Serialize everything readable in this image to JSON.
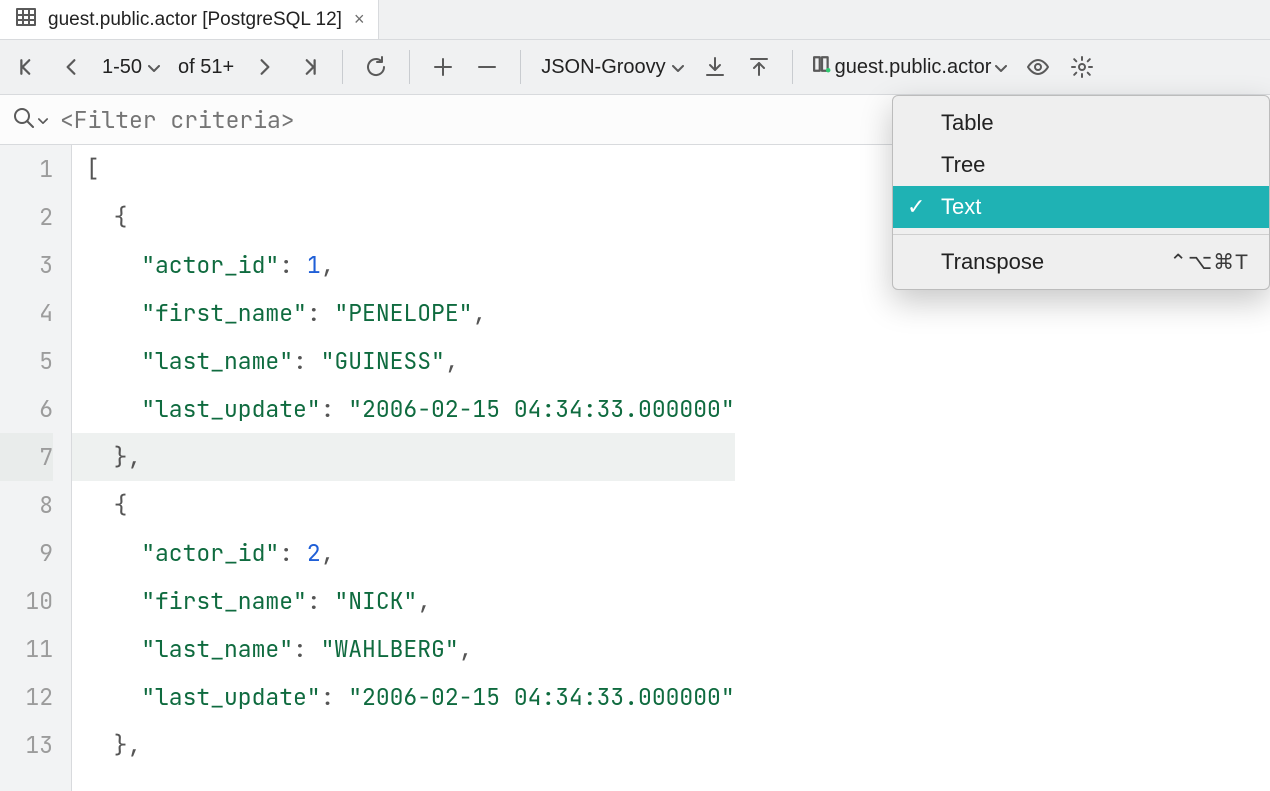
{
  "tab": {
    "title": "guest.public.actor [PostgreSQL 12]"
  },
  "toolbar": {
    "range": "1-50",
    "of_label": "of 51+",
    "format": "JSON-Groovy",
    "target": "guest.public.actor"
  },
  "filter": {
    "placeholder": "<Filter criteria>"
  },
  "code_tokens": [
    {
      "indent": 0,
      "parts": [
        {
          "t": "[",
          "c": "p"
        }
      ]
    },
    {
      "indent": 1,
      "parts": [
        {
          "t": "{",
          "c": "p"
        }
      ]
    },
    {
      "indent": 2,
      "parts": [
        {
          "t": "\"actor_id\"",
          "c": "k"
        },
        {
          "t": ": ",
          "c": "p"
        },
        {
          "t": "1",
          "c": "n"
        },
        {
          "t": ",",
          "c": "p"
        }
      ]
    },
    {
      "indent": 2,
      "parts": [
        {
          "t": "\"first_name\"",
          "c": "k"
        },
        {
          "t": ": ",
          "c": "p"
        },
        {
          "t": "\"PENELOPE\"",
          "c": "k"
        },
        {
          "t": ",",
          "c": "p"
        }
      ]
    },
    {
      "indent": 2,
      "parts": [
        {
          "t": "\"last_name\"",
          "c": "k"
        },
        {
          "t": ": ",
          "c": "p"
        },
        {
          "t": "\"GUINESS\"",
          "c": "k"
        },
        {
          "t": ",",
          "c": "p"
        }
      ]
    },
    {
      "indent": 2,
      "parts": [
        {
          "t": "\"last_update\"",
          "c": "k"
        },
        {
          "t": ": ",
          "c": "p"
        },
        {
          "t": "\"2006-02-15 04:34:33.000000\"",
          "c": "k"
        }
      ]
    },
    {
      "indent": 1,
      "hl": true,
      "parts": [
        {
          "t": "},",
          "c": "p"
        }
      ]
    },
    {
      "indent": 1,
      "parts": [
        {
          "t": "{",
          "c": "p"
        }
      ]
    },
    {
      "indent": 2,
      "parts": [
        {
          "t": "\"actor_id\"",
          "c": "k"
        },
        {
          "t": ": ",
          "c": "p"
        },
        {
          "t": "2",
          "c": "n"
        },
        {
          "t": ",",
          "c": "p"
        }
      ]
    },
    {
      "indent": 2,
      "parts": [
        {
          "t": "\"first_name\"",
          "c": "k"
        },
        {
          "t": ": ",
          "c": "p"
        },
        {
          "t": "\"NICK\"",
          "c": "k"
        },
        {
          "t": ",",
          "c": "p"
        }
      ]
    },
    {
      "indent": 2,
      "parts": [
        {
          "t": "\"last_name\"",
          "c": "k"
        },
        {
          "t": ": ",
          "c": "p"
        },
        {
          "t": "\"WAHLBERG\"",
          "c": "k"
        },
        {
          "t": ",",
          "c": "p"
        }
      ]
    },
    {
      "indent": 2,
      "parts": [
        {
          "t": "\"last_update\"",
          "c": "k"
        },
        {
          "t": ": ",
          "c": "p"
        },
        {
          "t": "\"2006-02-15 04:34:33.000000\"",
          "c": "k"
        }
      ]
    },
    {
      "indent": 1,
      "parts": [
        {
          "t": "},",
          "c": "p"
        }
      ]
    }
  ],
  "view_menu": {
    "items": [
      {
        "label": "Table",
        "selected": false
      },
      {
        "label": "Tree",
        "selected": false
      },
      {
        "label": "Text",
        "selected": true
      }
    ],
    "transpose": {
      "label": "Transpose",
      "shortcut": "⌃⌥⌘T"
    }
  }
}
